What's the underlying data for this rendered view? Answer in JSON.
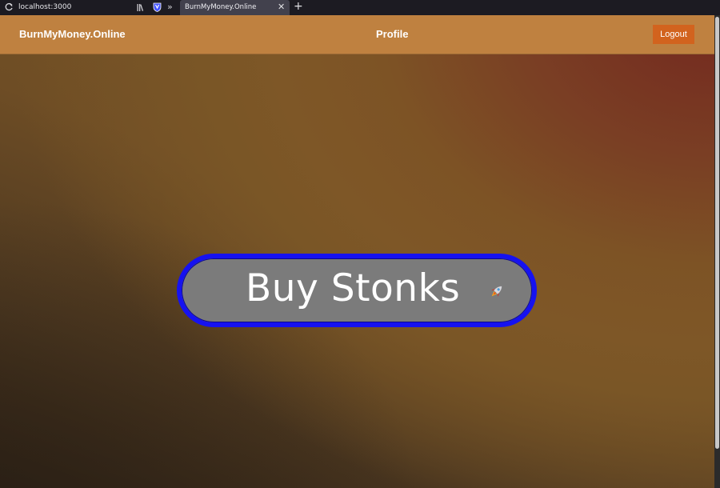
{
  "browser": {
    "url": "localhost:3000",
    "tab_title": "BurnMyMoney.Online",
    "overflow_symbol": "»",
    "close_symbol": "✕",
    "new_tab_symbol": "+"
  },
  "navbar": {
    "brand": "BurnMyMoney.Online",
    "profile_link": "Profile",
    "logout_label": "Logout"
  },
  "main": {
    "cta_label": "Buy Stonks",
    "cta_icon": "rocket-icon"
  },
  "colors": {
    "navbar_bg": "#bf8140",
    "logout_bg": "#d2631e",
    "cta_border": "#1612f0",
    "cta_bg": "#7b7b7b"
  }
}
